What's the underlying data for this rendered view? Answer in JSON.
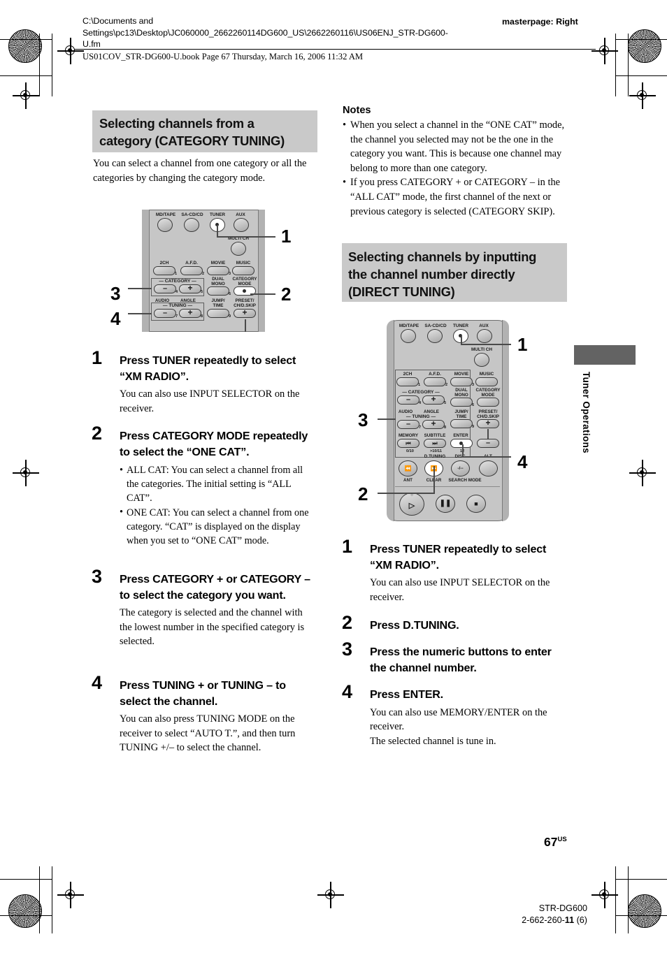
{
  "header": {
    "path_line1": "C:\\Documents and",
    "path_line2": "Settings\\pc13\\Desktop\\JC060000_2662260114DG600_US\\2662260116\\US06ENJ_STR-DG600-",
    "path_line3": "U.fm",
    "masterpage": "masterpage: Right",
    "book_line": "US01COV_STR-DG600-U.book  Page 67  Thursday, March 16, 2006  11:32 AM"
  },
  "left": {
    "heading_line1": "Selecting channels from a",
    "heading_line2": "category (CATEGORY TUNING)",
    "intro": "You can select a channel from one category or all the categories by changing the category mode.",
    "steps": [
      {
        "num": "1",
        "title": "Press TUNER repeatedly to select “XM RADIO”.",
        "body": "You can also use INPUT SELECTOR on the receiver."
      },
      {
        "num": "2",
        "title": "Press CATEGORY MODE repeatedly to select the “ONE CAT”.",
        "bullets": [
          "ALL CAT: You can select a channel from all the categories. The initial setting is “ALL CAT”.",
          "ONE CAT: You can select a channel from one category. “CAT” is displayed on the display when you set to “ONE CAT” mode."
        ]
      },
      {
        "num": "3",
        "title": "Press CATEGORY + or CATEGORY – to select the category you want.",
        "body": "The category is selected and the channel with the lowest number in the specified category is selected."
      },
      {
        "num": "4",
        "title": "Press TUNING + or TUNING – to select the channel.",
        "body": "You can also press TUNING MODE on the receiver to select “AUTO T.”, and then turn TUNING +/– to select the channel."
      }
    ]
  },
  "right": {
    "notes_heading": "Notes",
    "notes": [
      "When you select a channel in the “ONE CAT” mode, the channel you selected may not be the one in the category you want. This is because one channel may belong to more than one category.",
      "If you press CATEGORY + or CATEGORY – in the “ALL CAT” mode, the first channel of the next or previous category is selected (CATEGORY SKIP)."
    ],
    "heading_line1": "Selecting channels by inputting",
    "heading_line2": "the channel number directly",
    "heading_line3": "(DIRECT TUNING)",
    "steps": [
      {
        "num": "1",
        "title": "Press TUNER repeatedly to select “XM RADIO”.",
        "body": "You can also use INPUT SELECTOR on the receiver."
      },
      {
        "num": "2",
        "title": "Press D.TUNING."
      },
      {
        "num": "3",
        "title": "Press the numeric buttons to enter the channel number."
      },
      {
        "num": "4",
        "title": "Press ENTER.",
        "body": "You can also use MEMORY/ENTER on the receiver.\nThe selected channel is tune in."
      }
    ]
  },
  "sidetab": {
    "label": "Tuner Operations"
  },
  "footer": {
    "page_number": "67",
    "page_suffix": "US",
    "model": "STR-DG600",
    "part_prefix": "2-662-260-",
    "part_bold": "11",
    "part_suffix": " (6)"
  },
  "remote1": {
    "callouts": [
      "1",
      "2",
      "3",
      "4"
    ],
    "buttons": [
      {
        "label": "MD/TAPE"
      },
      {
        "label": "SA-CD/CD"
      },
      {
        "label": "TUNER"
      },
      {
        "label": "AUX"
      },
      {
        "label": "MULTI CH"
      },
      {
        "label": "2CH",
        "index": "1"
      },
      {
        "label": "A.F.D.",
        "index": "2"
      },
      {
        "label": "MOVIE",
        "index": "3"
      },
      {
        "label": "MUSIC"
      },
      {
        "label": "CATEGORY",
        "minus": "–",
        "index": "4"
      },
      {
        "label": "CATEGORY",
        "plus": "+",
        "index": "5"
      },
      {
        "label": "DUAL MONO",
        "index": "6"
      },
      {
        "label": "CATEGORY MODE"
      },
      {
        "label": "AUDIO",
        "group": "TUNING",
        "minus": "–",
        "index": "7"
      },
      {
        "label": "ANGLE",
        "group": "TUNING",
        "plus": "+",
        "index": "8"
      },
      {
        "label": "JUMP/ TIME",
        "index": "9"
      },
      {
        "label": "PRESET/ CH/D.SKIP",
        "plus": "+"
      }
    ],
    "group_labels": {
      "category": "— CATEGORY —",
      "tuning": "— TUNING —"
    }
  },
  "remote2": {
    "callouts": [
      "1",
      "2",
      "3",
      "4"
    ],
    "rows": {
      "source": [
        "MD/TAPE",
        "SA-CD/CD",
        "TUNER",
        "AUX"
      ],
      "multich": "MULTI CH",
      "r1": [
        "2CH",
        "A.F.D.",
        "MOVIE",
        "MUSIC"
      ],
      "r1_idx": [
        "1",
        "2",
        "3"
      ],
      "r2_top": [
        "— CATEGORY —",
        "DUAL MONO",
        "CATEGORY MODE"
      ],
      "r2_idx": [
        "4",
        "5",
        "6"
      ],
      "r3_top": [
        "AUDIO",
        "ANGLE",
        "JUMP/ TIME",
        "PRESET/ CH/D.SKIP"
      ],
      "r3_tuning": "— TUNING —",
      "r3_idx": [
        "7",
        "8",
        "9"
      ],
      "r4_top": [
        "MEMORY",
        "SUBTITLE",
        "ENTER"
      ],
      "r4_sub": [
        "0/10",
        ">10/11",
        "12"
      ],
      "r5_top": [
        "D.TUNING",
        "DISC",
        "ALT"
      ],
      "r5_bot": [
        "ANT",
        "CLEAR",
        "SEARCH MODE"
      ]
    }
  }
}
